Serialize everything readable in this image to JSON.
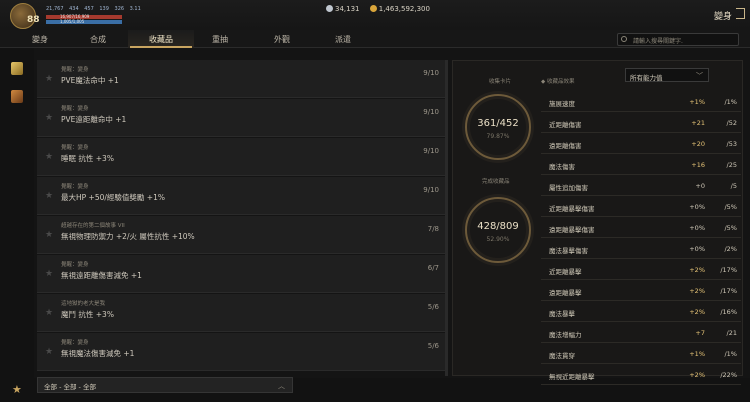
{
  "header": {
    "level": "88",
    "stats": [
      "21,767",
      "434",
      "457",
      "139",
      "326",
      "3.11"
    ],
    "hp_text": "16,907/16,909",
    "mp_text": "1,005/1,005",
    "hp_fraction": 1.0,
    "mp_fraction": 1.0,
    "currency1": "34,131",
    "currency2": "1,463,592,300",
    "title": "變身"
  },
  "tabs": [
    {
      "label": "變身"
    },
    {
      "label": "合成"
    },
    {
      "label": "收藏品"
    },
    {
      "label": "重抽"
    },
    {
      "label": "外觀"
    },
    {
      "label": "派遣"
    }
  ],
  "search": {
    "placeholder": "請輸入搜尋關鍵字."
  },
  "list": [
    {
      "cat": "覺醒：變身",
      "name": "PVE魔法命中 +1",
      "prog": "9/10"
    },
    {
      "cat": "覺醒：變身",
      "name": "PVE遠距離命中 +1",
      "prog": "9/10"
    },
    {
      "cat": "覺醒：變身",
      "name": "睡眠 抗性 +3%",
      "prog": "9/10"
    },
    {
      "cat": "覺醒：變身",
      "name": "最大HP +50/經驗值獎勵 +1%",
      "prog": "9/10"
    },
    {
      "cat": "超越存在的第二個故事 VII",
      "name": "無視物理防禦力 +2/火 屬性抗性 +10%",
      "prog": "7/8"
    },
    {
      "cat": "覺醒：變身",
      "name": "無視遠距離傷害減免 +1",
      "prog": "6/7"
    },
    {
      "cat": "這地獄的老大是我",
      "name": "魔鬥 抗性 +3%",
      "prog": "5/6"
    },
    {
      "cat": "覺醒：變身",
      "name": "無視魔法傷害減免 +1",
      "prog": "5/6"
    }
  ],
  "filter": {
    "label": "全部 - 全部 - 全部"
  },
  "panel": {
    "collect_label": "收集卡片",
    "collect_value": "361/452",
    "collect_pct": "79.87%",
    "complete_label": "完成收藏品",
    "complete_value": "428/809",
    "complete_pct": "52.90%",
    "effects_label": "◆ 收藏品效果",
    "select_value": "所有能力值"
  },
  "effects": [
    {
      "name": "施展速度",
      "value": "+1%",
      "max": "/1%",
      "gold": true
    },
    {
      "name": "近距離傷害",
      "value": "+21",
      "max": "/52",
      "gold": true
    },
    {
      "name": "遠距離傷害",
      "value": "+20",
      "max": "/53",
      "gold": true
    },
    {
      "name": "魔法傷害",
      "value": "+16",
      "max": "/25",
      "gold": true
    },
    {
      "name": "屬性追加傷害",
      "value": "+0",
      "max": "/5",
      "gold": false
    },
    {
      "name": "近距離暴擊傷害",
      "value": "+0%",
      "max": "/5%",
      "gold": false
    },
    {
      "name": "遠距離暴擊傷害",
      "value": "+0%",
      "max": "/5%",
      "gold": false
    },
    {
      "name": "魔法暴擊傷害",
      "value": "+0%",
      "max": "/2%",
      "gold": false
    },
    {
      "name": "近距離暴擊",
      "value": "+2%",
      "max": "/17%",
      "gold": true
    },
    {
      "name": "遠距離暴擊",
      "value": "+2%",
      "max": "/17%",
      "gold": true
    },
    {
      "name": "魔法暴擊",
      "value": "+2%",
      "max": "/16%",
      "gold": true
    },
    {
      "name": "魔法增幅力",
      "value": "+7",
      "max": "/21",
      "gold": true
    },
    {
      "name": "魔法貫穿",
      "value": "+1%",
      "max": "/1%",
      "gold": true
    },
    {
      "name": "無視近距離暴擊",
      "value": "+2%",
      "max": "/22%",
      "gold": true
    }
  ]
}
